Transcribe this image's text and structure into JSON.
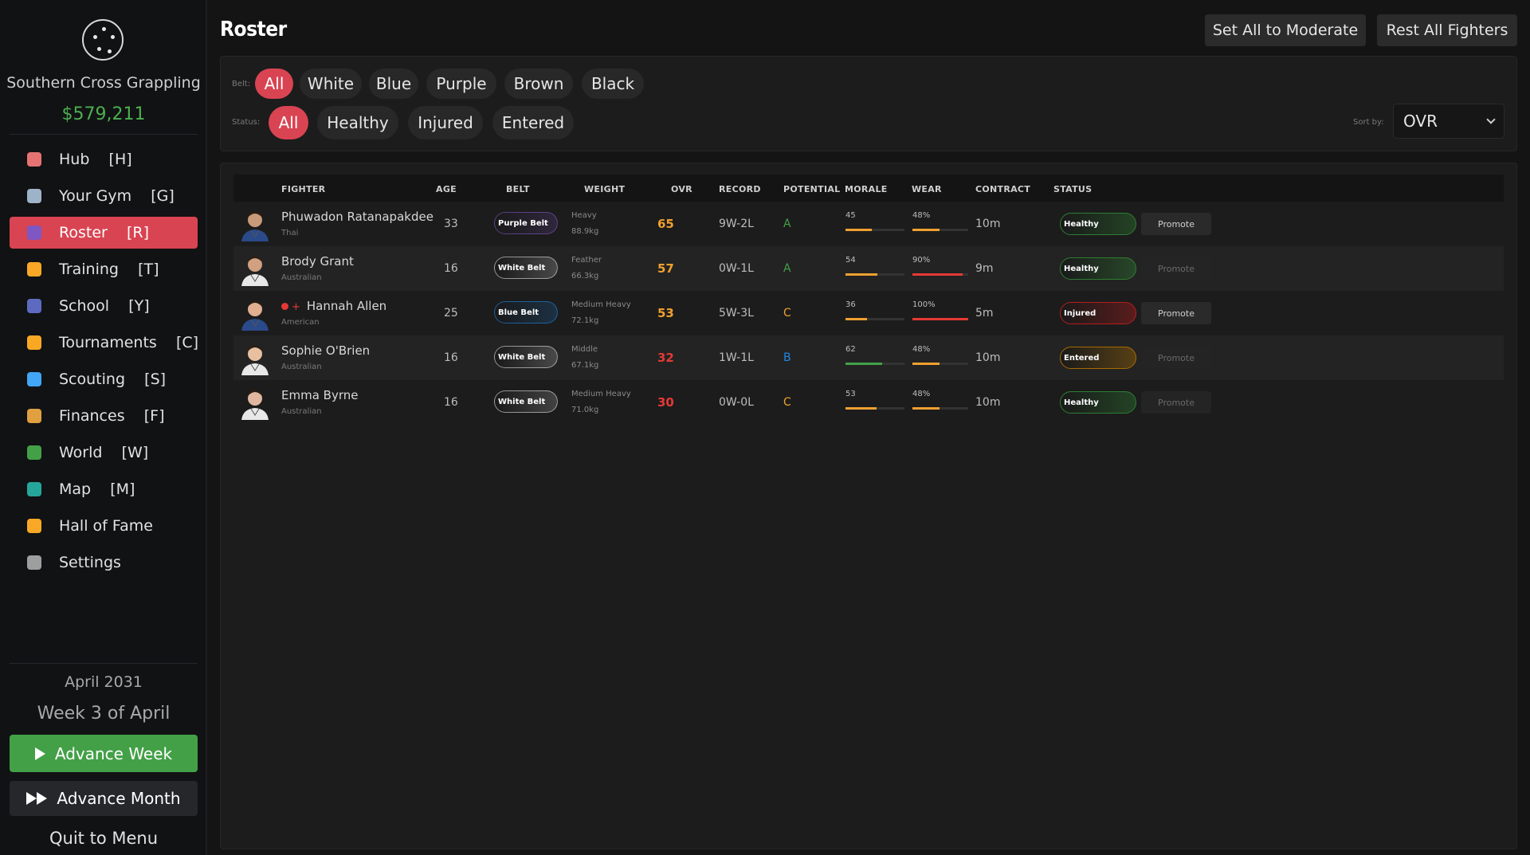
{
  "sidebar": {
    "gym_name": "Southern Cross Grappling",
    "money": "$579,211",
    "nav": [
      {
        "label": "Hub    [H]",
        "icon": "house-icon",
        "color": "#e57373"
      },
      {
        "label": "Your Gym    [G]",
        "icon": "building-icon",
        "color": "#9fb3c8"
      },
      {
        "label": "Roster    [R]",
        "icon": "people-icon",
        "color": "#7e57c2"
      },
      {
        "label": "Training    [T]",
        "icon": "trophy-icon",
        "color": "#f9a825"
      },
      {
        "label": "School    [Y]",
        "icon": "horn-icon",
        "color": "#5c6bc0"
      },
      {
        "label": "Tournaments    [C]",
        "icon": "trophy-icon",
        "color": "#f9a825"
      },
      {
        "label": "Scouting    [S]",
        "icon": "magnifier-icon",
        "color": "#42a5f5"
      },
      {
        "label": "Finances    [F]",
        "icon": "money-bag-icon",
        "color": "#e0a040"
      },
      {
        "label": "World    [W]",
        "icon": "globe-icon",
        "color": "#43a047"
      },
      {
        "label": "Map    [M]",
        "icon": "map-icon",
        "color": "#26a69a"
      },
      {
        "label": "Hall of Fame",
        "icon": "medal-icon",
        "color": "#f9a825"
      },
      {
        "label": "Settings",
        "icon": "gear-icon",
        "color": "#9e9e9e"
      }
    ],
    "active_index": 2,
    "month": "April 2031",
    "week": "Week 3 of April",
    "advance_week": "Advance Week",
    "advance_month": "Advance Month",
    "quit": "Quit to Menu"
  },
  "header": {
    "title": "Roster",
    "set_moderate": "Set All to Moderate",
    "rest_all": "Rest All Fighters"
  },
  "filters": {
    "belt_label": "Belt:",
    "belts": [
      "All",
      "White",
      "Blue",
      "Purple",
      "Brown",
      "Black"
    ],
    "status_label": "Status:",
    "statuses": [
      "All",
      "Healthy",
      "Injured",
      "Entered"
    ],
    "sort_label": "Sort by:",
    "sort_value": "OVR"
  },
  "table": {
    "headers": [
      "FIGHTER",
      "AGE",
      "BELT",
      "WEIGHT",
      "OVR",
      "RECORD",
      "POTENTIAL",
      "MORALE",
      "WEAR",
      "CONTRACT",
      "STATUS"
    ],
    "rows": [
      {
        "name": "Phuwadon Ratanapakdee",
        "nationality": "Thai",
        "injured": false,
        "age": "33",
        "belt": "Purple Belt",
        "belt_color": "#7e57c2",
        "weight_class": "Heavy",
        "weight": "88.9kg",
        "ovr": "65",
        "ovr_color": "#f0a030",
        "record": "9W-2L",
        "potential": "A",
        "potential_color": "#43a047",
        "morale": 45,
        "wear": "48%",
        "wear_value": 48,
        "contract": "10m",
        "status": "Healthy",
        "promote": "Promote",
        "promote_enabled": true
      },
      {
        "name": "Brody Grant",
        "nationality": "Australian",
        "injured": false,
        "age": "16",
        "belt": "White Belt",
        "belt_color": "#e0e0e0",
        "weight_class": "Feather",
        "weight": "66.3kg",
        "ovr": "57",
        "ovr_color": "#f0a030",
        "record": "0W-1L",
        "potential": "A",
        "potential_color": "#43a047",
        "morale": 54,
        "wear": "90%",
        "wear_value": 90,
        "contract": "9m",
        "status": "Healthy",
        "promote": "Promote",
        "promote_enabled": false
      },
      {
        "name": "Hannah Allen",
        "nationality": "American",
        "injured": true,
        "injury_mark": "+",
        "age": "25",
        "belt": "Blue Belt",
        "belt_color": "#1e88e5",
        "weight_class": "Medium Heavy",
        "weight": "72.1kg",
        "ovr": "53",
        "ovr_color": "#f0a030",
        "record": "5W-3L",
        "potential": "C",
        "potential_color": "#f0a030",
        "morale": 36,
        "wear": "100%",
        "wear_value": 100,
        "contract": "5m",
        "status": "Injured",
        "promote": "Promote",
        "promote_enabled": true
      },
      {
        "name": "Sophie O'Brien",
        "nationality": "Australian",
        "injured": false,
        "age": "16",
        "belt": "White Belt",
        "belt_color": "#e0e0e0",
        "weight_class": "Middle",
        "weight": "67.1kg",
        "ovr": "32",
        "ovr_color": "#e53935",
        "record": "1W-1L",
        "potential": "B",
        "potential_color": "#1e88e5",
        "morale": 62,
        "wear": "48%",
        "wear_value": 48,
        "contract": "10m",
        "status": "Entered",
        "promote": "Promote",
        "promote_enabled": false
      },
      {
        "name": "Emma Byrne",
        "nationality": "Australian",
        "injured": false,
        "age": "16",
        "belt": "White Belt",
        "belt_color": "#e0e0e0",
        "weight_class": "Medium Heavy",
        "weight": "71.0kg",
        "ovr": "30",
        "ovr_color": "#e53935",
        "record": "0W-0L",
        "potential": "C",
        "potential_color": "#f0a030",
        "morale": 53,
        "wear": "48%",
        "wear_value": 48,
        "contract": "10m",
        "status": "Healthy",
        "promote": "Promote",
        "promote_enabled": false
      }
    ]
  },
  "colors": {
    "accent": "#d94452",
    "money": "#4caf50",
    "healthy": "#2e7d32",
    "injured": "#b71c1c",
    "entered": "#a66a00",
    "morale_low": "#f0a030",
    "morale_high": "#43a047",
    "wear_ok": "#f0a030",
    "wear_high": "#e53935"
  }
}
